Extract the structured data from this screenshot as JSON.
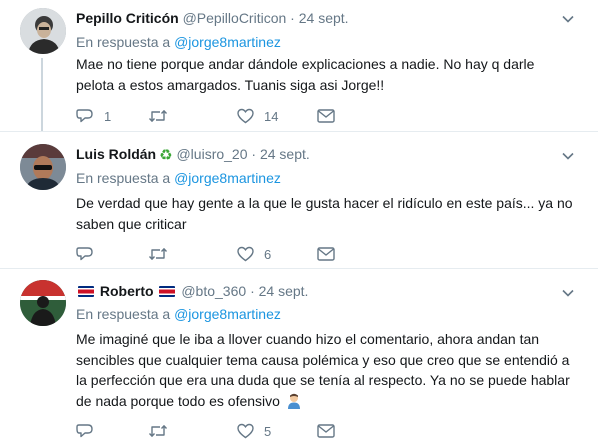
{
  "tweets": [
    {
      "name": "Pepillo Criticón",
      "handle": "@PepilloCriticon",
      "separator": "·",
      "time": "24 sept.",
      "reply_prefix": "En respuesta a",
      "reply_mention": "@jorge8martinez",
      "text": "Mae  no tiene porque andar dándole explicaciones a nadie. No hay q darle pelota a estos amargados. Tuanis siga asi Jorge!!",
      "replies": "1",
      "retweets": "",
      "likes": "14"
    },
    {
      "name": "Luis Roldán",
      "name_emoji": "♻",
      "handle": "@luisro_20",
      "separator": "·",
      "time": "24 sept.",
      "reply_prefix": "En respuesta a",
      "reply_mention": "@jorge8martinez",
      "text": "De verdad que hay gente a la que le gusta hacer el ridículo en este país... ya no saben que criticar",
      "replies": "",
      "retweets": "",
      "likes": "6"
    },
    {
      "name": "Roberto",
      "handle": "@bto_360",
      "separator": "·",
      "time": "24 sept.",
      "reply_prefix": "En respuesta a",
      "reply_mention": "@jorge8martinez",
      "text": "Me imaginé que le iba a llover cuando hizo el comentario, ahora andan tan sencibles que cualquier tema causa polémica y eso que creo que se entendió a la perfección que era una duda que se tenía al respecto. Ya no se puede hablar de nada porque todo es ofensivo",
      "replies": "",
      "retweets": "",
      "likes": "5"
    }
  ],
  "colors": {
    "text": "#14171a",
    "secondary": "#657786",
    "link": "#1b95e0",
    "divider": "#e6ecf0",
    "thread_line": "#ccd6dd"
  },
  "icons": [
    "reply-icon",
    "retweet-icon",
    "like-icon",
    "direct-message-icon",
    "chevron-down-icon",
    "costa-rica-flag-icon",
    "recycle-emoji-icon",
    "man-shrugging-emoji-icon"
  ]
}
